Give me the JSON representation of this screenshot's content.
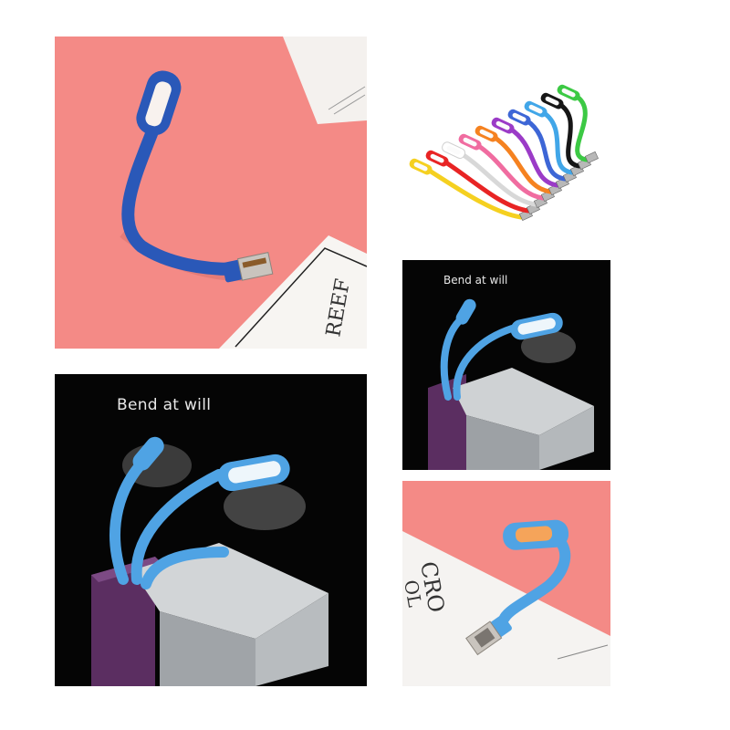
{
  "captions": {
    "top_right": "Bend at will",
    "bottom_left": "Bend at will"
  },
  "colors": {
    "pink_background": "#f48a86",
    "black_background": "#050505",
    "lamp_dark_blue": "#2a58b8",
    "lamp_light_blue": "#4fa3e4",
    "power_bank_silver": "#bfc3c6",
    "power_bank_purple": "#5b2e61",
    "lamp_colors": [
      "#f5d020",
      "#e82424",
      "#ffffff",
      "#f06ca0",
      "#f58220",
      "#9b3bc7",
      "#3d66d6",
      "#41a6e8",
      "#161616",
      "#3cc944"
    ]
  }
}
